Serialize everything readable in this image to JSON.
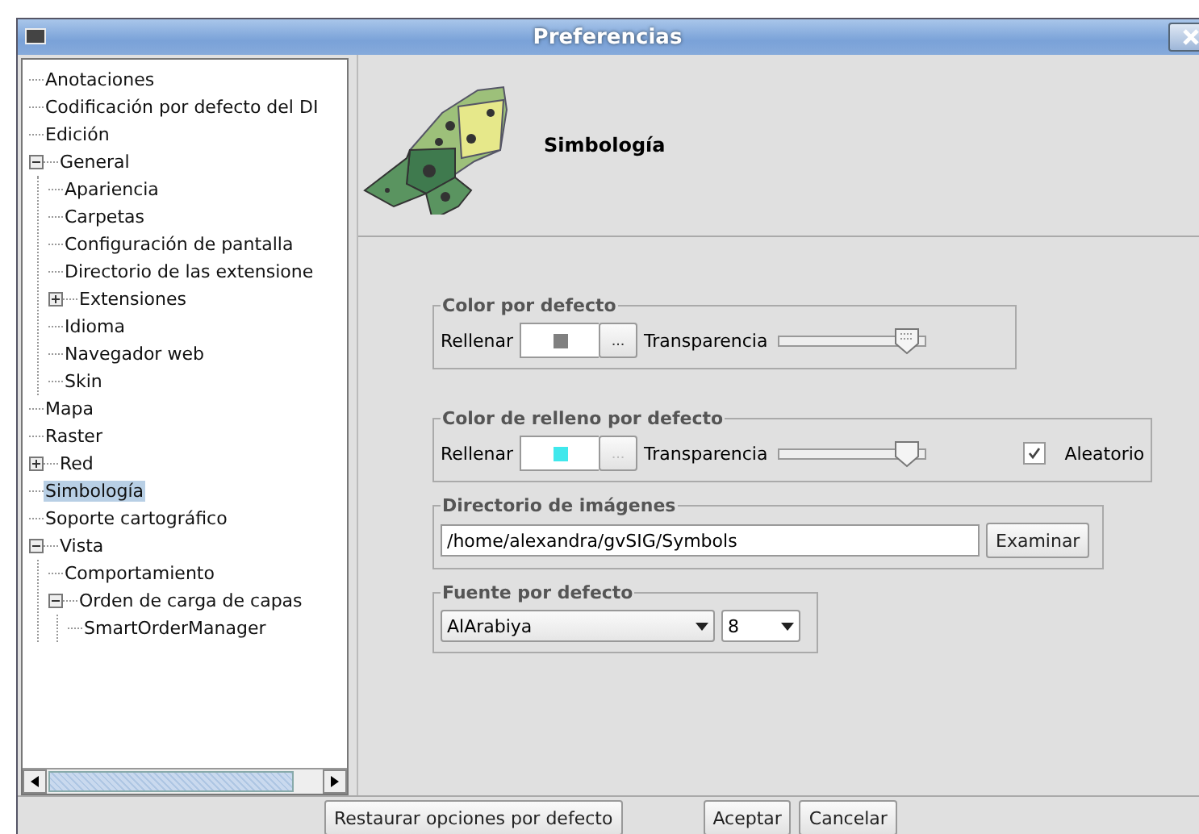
{
  "window": {
    "title": "Preferencias"
  },
  "tree": [
    {
      "label": "Anotaciones",
      "selected": false
    },
    {
      "label": "Codificación por defecto del DI",
      "selected": false
    },
    {
      "label": "Edición",
      "selected": false
    },
    {
      "label": "General",
      "selected": false,
      "expanded": true,
      "children": [
        {
          "label": "Apariencia",
          "selected": false
        },
        {
          "label": "Carpetas",
          "selected": false
        },
        {
          "label": "Configuración de pantalla",
          "selected": false
        },
        {
          "label": "Directorio de las extensione",
          "selected": false
        },
        {
          "label": "Extensiones",
          "selected": false,
          "expanded": false
        },
        {
          "label": "Idioma",
          "selected": false
        },
        {
          "label": "Navegador web",
          "selected": false
        },
        {
          "label": "Skin",
          "selected": false
        }
      ]
    },
    {
      "label": "Mapa",
      "selected": false
    },
    {
      "label": "Raster",
      "selected": false
    },
    {
      "label": "Red",
      "selected": false,
      "expanded": false
    },
    {
      "label": "Simbología",
      "selected": true
    },
    {
      "label": "Soporte cartográfico",
      "selected": false
    },
    {
      "label": "Vista",
      "selected": false,
      "expanded": true,
      "children": [
        {
          "label": "Comportamiento",
          "selected": false
        },
        {
          "label": "Orden de carga de capas",
          "selected": false,
          "expanded": true,
          "children": [
            {
              "label": "SmartOrderManager",
              "selected": false
            }
          ]
        }
      ]
    }
  ],
  "header": {
    "title": "Simbología"
  },
  "default_color": {
    "legend": "Color por defecto",
    "fill_label": "Rellenar",
    "color": "#808080",
    "browse": {
      "label": "...",
      "disabled": false
    },
    "transparency_label": "Transparencia",
    "level": 0.95
  },
  "default_fill": {
    "legend": "Color de relleno por defecto",
    "fill_label": "Rellenar",
    "color": "#40e8ec",
    "browse": {
      "label": "...",
      "disabled": true
    },
    "transparency_label": "Transparencia",
    "level": 0.95,
    "random": {
      "label": "Aleatorio",
      "checked": true
    }
  },
  "image_dir": {
    "legend": "Directorio de imágenes",
    "value": "/home/alexandra/gvSIG/Symbols",
    "browse": "Examinar"
  },
  "default_font": {
    "legend": "Fuente por defecto",
    "font": "AlArabiya",
    "size": "8"
  },
  "buttons": [
    {
      "label": "Restaurar opciones por defecto"
    },
    {
      "label": "Aceptar"
    },
    {
      "label": "Cancelar"
    }
  ]
}
